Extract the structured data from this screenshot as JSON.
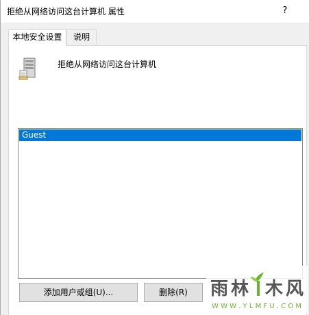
{
  "window": {
    "title": "拒绝从网络访问这台计算机 属性",
    "help_label": "?"
  },
  "tabs": [
    {
      "label": "本地安全设置",
      "active": true
    },
    {
      "label": "说明",
      "active": false
    }
  ],
  "policy": {
    "name": "拒绝从网络访问这台计算机",
    "icon": "server-icon"
  },
  "user_list": {
    "items": [
      {
        "label": "Guest",
        "selected": true
      }
    ]
  },
  "buttons": {
    "add_label": "添加用户或组(U)...",
    "remove_label": "删除(R)"
  },
  "watermark": {
    "brand": "雨林木风",
    "url": "W W W . Y L M F U . C O M"
  },
  "colors": {
    "selection": "#0078d7",
    "window_bg": "#f0f0f0",
    "watermark_green": "#6ab42d"
  }
}
